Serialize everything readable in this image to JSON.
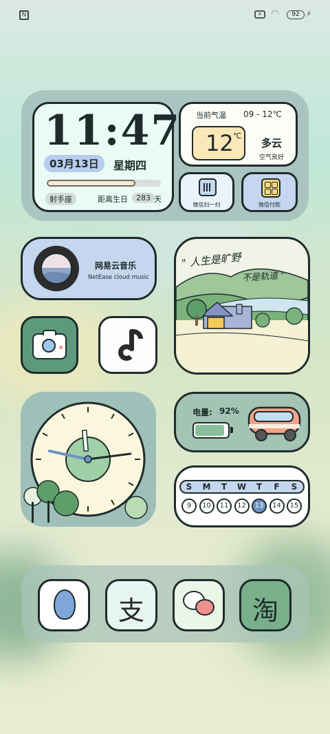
{
  "status_bar": {
    "nfc_icon": "nfc-icon",
    "battery": "92"
  },
  "clock_widget": {
    "time": "11:47",
    "date": "03月13日",
    "weekday": "星期四",
    "year_progress": 0.78,
    "zodiac": "射手座",
    "birthday_label": "距离生日",
    "birthday_days": "283",
    "birthday_unit": "天"
  },
  "weather_widget": {
    "label": "当前气温",
    "range": "09 - 12℃",
    "temp": "12",
    "unit": "℃",
    "condition": "多云",
    "air": "空气良好"
  },
  "wechat_scan": {
    "label": "微信扫一扫"
  },
  "wechat_pay": {
    "label": "微信付款"
  },
  "music_widget": {
    "title": "网易云音乐",
    "subtitle": "NetEase cloud music"
  },
  "photo_widget": {
    "line1": "\" 人生是旷野",
    "line2": "不是轨道 \""
  },
  "battery_widget": {
    "label": "电量:",
    "value": "92%",
    "level": 0.92
  },
  "calendar_widget": {
    "weekdays": [
      "S",
      "M",
      "T",
      "W",
      "T",
      "F",
      "S"
    ],
    "days": [
      "9",
      "10",
      "11",
      "12",
      "13",
      "14",
      "15"
    ],
    "today": "13"
  },
  "colors": {
    "accent_green": "#5d9a7b",
    "cream": "#fbf7de",
    "blue_pill": "#c5d6ef"
  }
}
